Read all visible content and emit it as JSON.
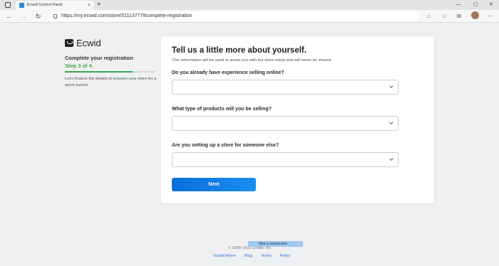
{
  "browser": {
    "tab_title": "Ecwid Control Panel",
    "tab_close": "×",
    "new_tab": "+",
    "url": "https://my.ecwid.com/store/51113777#complete-registration",
    "nav": {
      "back": "←",
      "forward": "→",
      "reload": "↻"
    },
    "window_controls": {
      "minimize": "—",
      "maximize": "▢",
      "close": "✕"
    }
  },
  "sidebar": {
    "logo_text": "Ecwid",
    "title": "Complete your registration",
    "step": "Step 3 of 4.",
    "progress_fraction": 0.75,
    "description": "Let's finalize the details to prepare your store for a quick launch."
  },
  "card": {
    "title": "Tell us a little more about yourself.",
    "subtitle": "This information will be used to assist you with the store setup and will never be shared.",
    "questions": [
      {
        "label": "Do you already have experience selling online?",
        "value": ""
      },
      {
        "label": "What type of products will you be selling?",
        "value": ""
      },
      {
        "label": "Are you setting up a store for someone else?",
        "value": ""
      }
    ],
    "next_label": "Next"
  },
  "footer": {
    "copyright": "© 2009–2021 Ecwid, Inc.",
    "screenshot_tip": "Take a screenshot",
    "links": [
      "Ecwid Home",
      "Blog",
      "Terms",
      "Policy"
    ]
  },
  "colors": {
    "accent_blue": "#0a6ddc",
    "step_green": "#3aa94e",
    "link_blue": "#2a74d8"
  }
}
